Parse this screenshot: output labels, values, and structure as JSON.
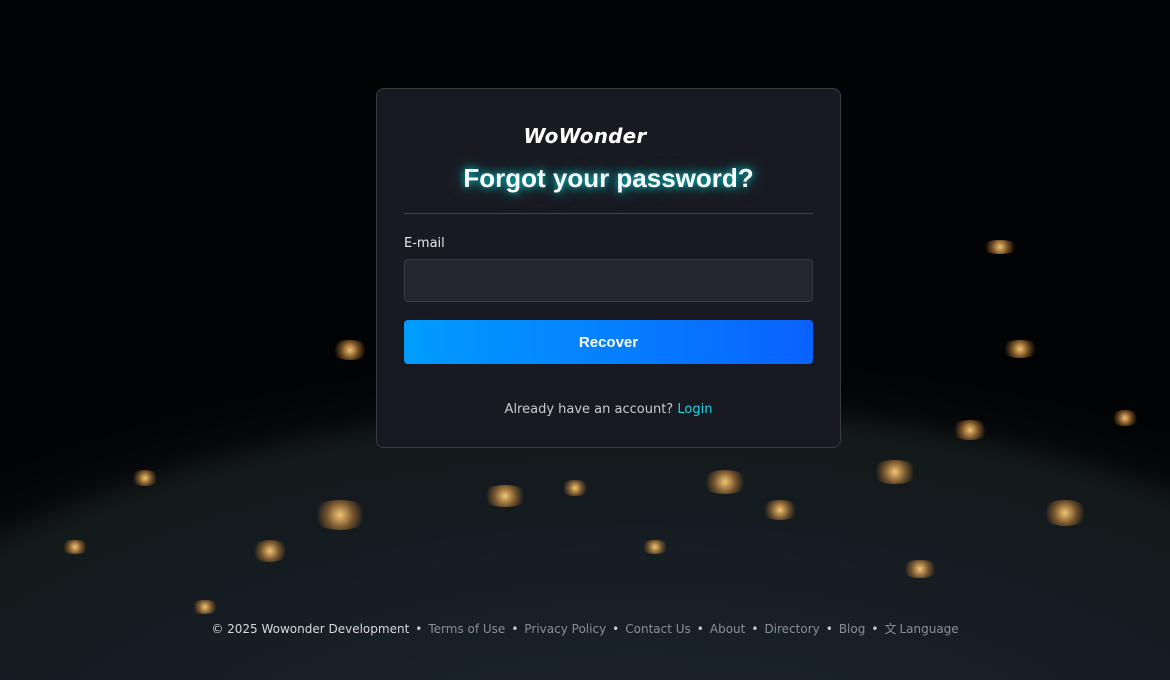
{
  "brand": {
    "logo_text": "WoWonder"
  },
  "form": {
    "title": "Forgot your password?",
    "email_label": "E-mail",
    "email_value": "",
    "email_placeholder": "",
    "submit_label": "Recover",
    "login_prompt": "Already have an account?",
    "login_link": "Login"
  },
  "footer": {
    "copyright": "© 2025 Wowonder Development",
    "links": [
      "Terms of Use",
      "Privacy Policy",
      "Contact Us",
      "About",
      "Directory",
      "Blog"
    ],
    "language_label": "Language",
    "language_icon": "translate-icon"
  },
  "colors": {
    "accent": "#009dff",
    "link": "#19d3e6",
    "divider": "#9a1f28",
    "card": "#1a1b22"
  }
}
